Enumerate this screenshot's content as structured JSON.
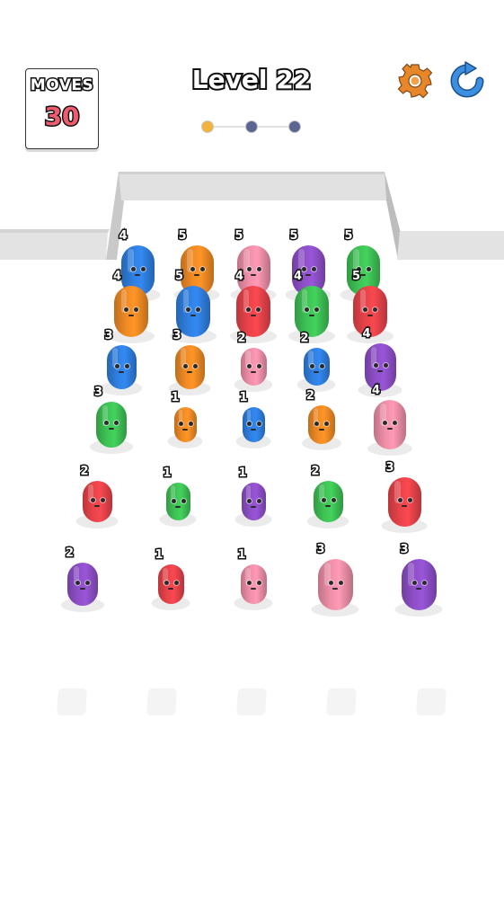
{
  "hud": {
    "moves_label": "MOVES",
    "moves_value": "30",
    "level_title": "Level 22"
  },
  "progress": {
    "total_stages": 3,
    "current_stage": 1,
    "colors": {
      "done": "#f2b33d",
      "pending": "#5b6690"
    }
  },
  "icons": {
    "settings": "gear-icon",
    "restart": "restart-arrow-icon"
  },
  "palette": {
    "blue": "#2f7fe0",
    "orange": "#f08a24",
    "pink": "#ef8fa8",
    "purple": "#8e4fc8",
    "green": "#3ec255",
    "red": "#e8434a"
  },
  "pieces": [
    {
      "row": 1,
      "col": 1,
      "color": "blue",
      "number": "4"
    },
    {
      "row": 1,
      "col": 2,
      "color": "orange",
      "number": "5"
    },
    {
      "row": 1,
      "col": 3,
      "color": "pink",
      "number": "5"
    },
    {
      "row": 1,
      "col": 4,
      "color": "purple",
      "number": "5"
    },
    {
      "row": 1,
      "col": 5,
      "color": "green",
      "number": "5"
    },
    {
      "row": 2,
      "col": 1,
      "color": "orange",
      "number": "4"
    },
    {
      "row": 2,
      "col": 2,
      "color": "blue",
      "number": "5"
    },
    {
      "row": 2,
      "col": 3,
      "color": "red",
      "number": "4"
    },
    {
      "row": 2,
      "col": 4,
      "color": "green",
      "number": "4"
    },
    {
      "row": 2,
      "col": 5,
      "color": "red",
      "number": "5"
    },
    {
      "row": 3,
      "col": 1,
      "color": "blue",
      "number": "3"
    },
    {
      "row": 3,
      "col": 2,
      "color": "orange",
      "number": "3"
    },
    {
      "row": 3,
      "col": 3,
      "color": "pink",
      "number": "2"
    },
    {
      "row": 3,
      "col": 4,
      "color": "blue",
      "number": "2"
    },
    {
      "row": 3,
      "col": 5,
      "color": "purple",
      "number": "4"
    },
    {
      "row": 4,
      "col": 1,
      "color": "green",
      "number": "3"
    },
    {
      "row": 4,
      "col": 2,
      "color": "orange",
      "number": "1"
    },
    {
      "row": 4,
      "col": 3,
      "color": "blue",
      "number": "1"
    },
    {
      "row": 4,
      "col": 4,
      "color": "orange",
      "number": "2"
    },
    {
      "row": 4,
      "col": 5,
      "color": "pink",
      "number": "4"
    },
    {
      "row": 5,
      "col": 1,
      "color": "red",
      "number": "2"
    },
    {
      "row": 5,
      "col": 2,
      "color": "green",
      "number": "1"
    },
    {
      "row": 5,
      "col": 3,
      "color": "purple",
      "number": "1"
    },
    {
      "row": 5,
      "col": 4,
      "color": "green",
      "number": "2"
    },
    {
      "row": 5,
      "col": 5,
      "color": "red",
      "number": "3"
    },
    {
      "row": 6,
      "col": 1,
      "color": "purple",
      "number": "2"
    },
    {
      "row": 6,
      "col": 2,
      "color": "red",
      "number": "1"
    },
    {
      "row": 6,
      "col": 3,
      "color": "pink",
      "number": "1"
    },
    {
      "row": 6,
      "col": 4,
      "color": "pink",
      "number": "3"
    },
    {
      "row": 6,
      "col": 5,
      "color": "purple",
      "number": "3"
    }
  ],
  "slots": {
    "count": 5,
    "filled": 0
  }
}
